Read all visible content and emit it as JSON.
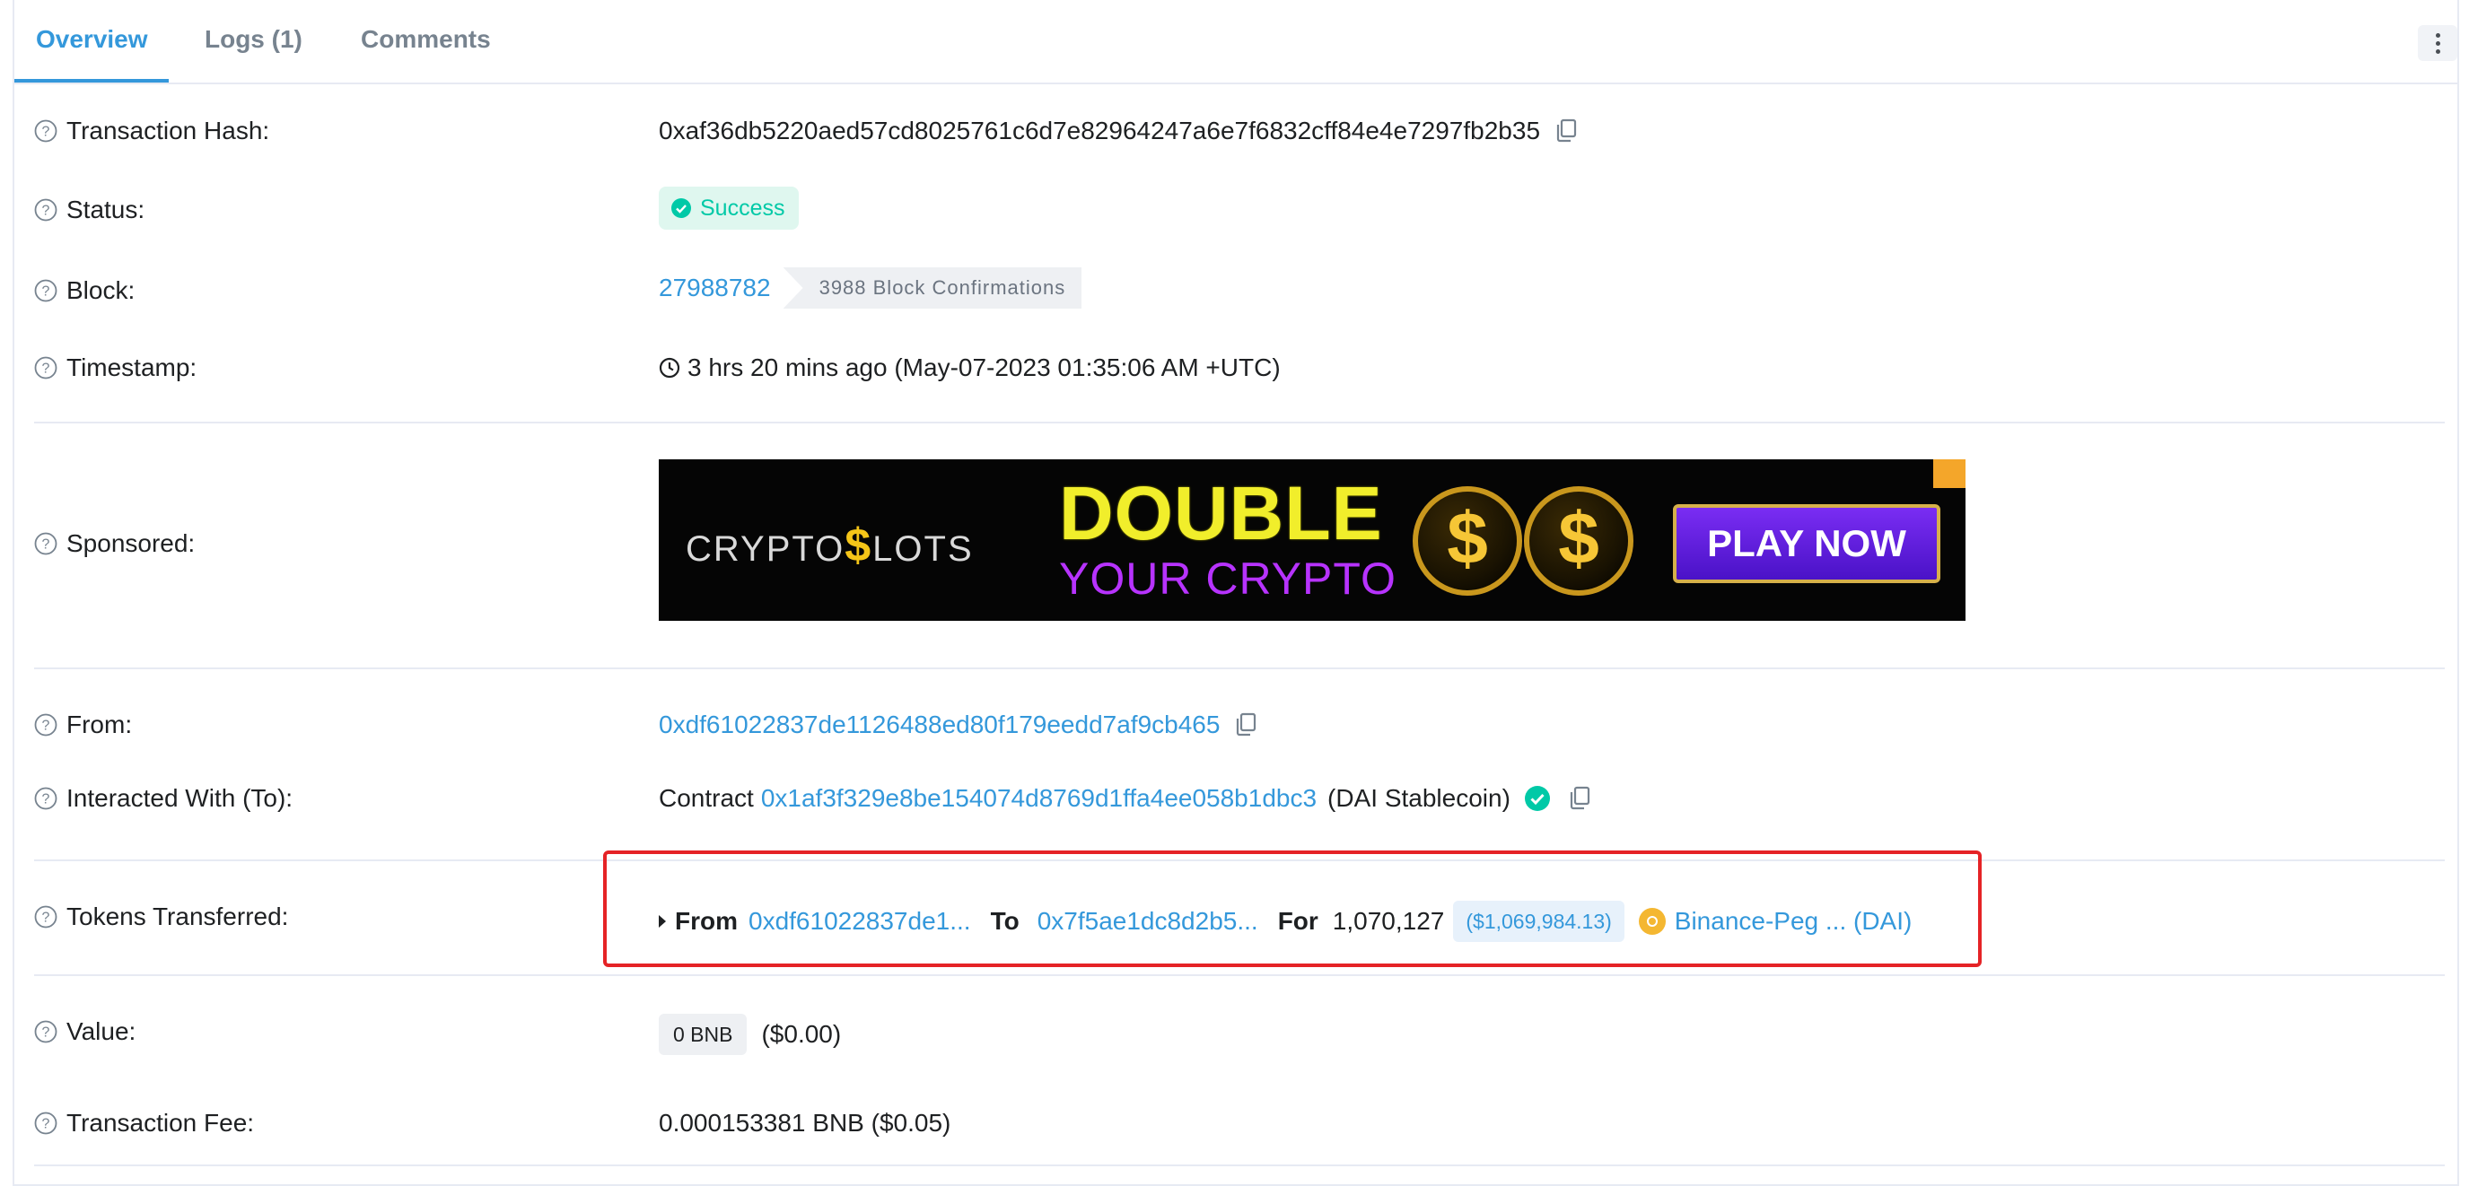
{
  "tabs": {
    "overview": "Overview",
    "logs": "Logs (1)",
    "comments": "Comments"
  },
  "labels": {
    "tx_hash": "Transaction Hash:",
    "status": "Status:",
    "block": "Block:",
    "timestamp": "Timestamp:",
    "sponsored": "Sponsored:",
    "from": "From:",
    "interacted": "Interacted With (To):",
    "tokens": "Tokens Transferred:",
    "value": "Value:",
    "fee": "Transaction Fee:"
  },
  "values": {
    "tx_hash": "0xaf36db5220aed57cd8025761c6d7e82964247a6e7f6832cff84e4e7297fb2b35",
    "status": "Success",
    "block_number": "27988782",
    "block_confirmations": "3988 Block Confirmations",
    "timestamp": "3 hrs 20 mins ago (May-07-2023 01:35:06 AM +UTC)",
    "from_address": "0xdf61022837de1126488ed80f179eedd7af9cb465",
    "contract_prefix": "Contract",
    "contract_address": "0x1af3f329e8be154074d8769d1ffa4ee058b1dbc3",
    "contract_name": "(DAI Stablecoin)",
    "value_chip": "0 BNB",
    "value_usd": "($0.00)",
    "fee": "0.000153381 BNB ($0.05)"
  },
  "ad": {
    "brand_left": "CRYPTO",
    "brand_dollar": "$",
    "brand_right": "LOTS",
    "headline1": "DOUBLE",
    "headline2": "YOUR CRYPTO",
    "coin_symbol": "$",
    "cta": "PLAY NOW"
  },
  "token_transfer": {
    "from_label": "From",
    "from_address": "0xdf61022837de1...",
    "to_label": "To",
    "to_address": "0x7f5ae1dc8d2b5...",
    "for_label": "For",
    "amount": "1,070,127",
    "usd": "($1,069,984.13)",
    "token_name": "Binance-Peg ... (DAI)"
  },
  "colors": {
    "link": "#3498db",
    "success": "#00c9a7",
    "highlight": "#e52326"
  }
}
